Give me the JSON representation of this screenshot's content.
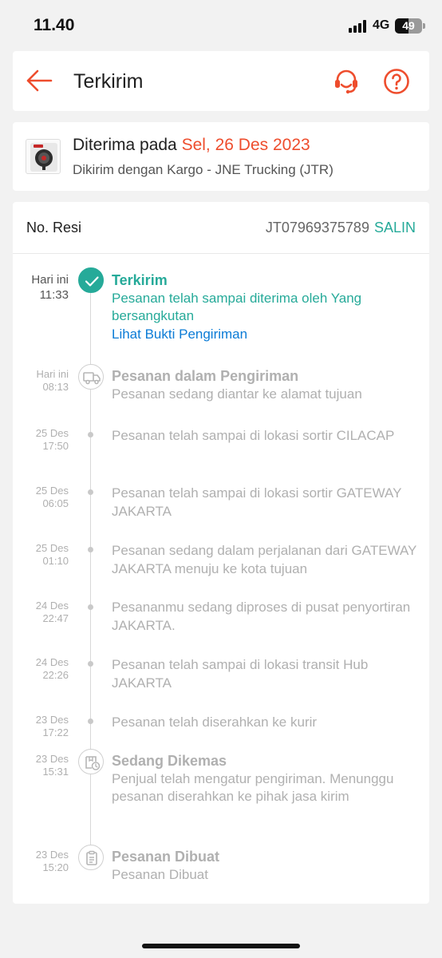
{
  "status_bar": {
    "time": "11.40",
    "network": "4G",
    "battery": "49",
    "battery_level": 0.49
  },
  "header": {
    "title": "Terkirim",
    "back_icon": "arrow-left-icon",
    "support_icon": "headset-icon",
    "help_icon": "question-circle-icon"
  },
  "colors": {
    "accent": "#ee4d2d",
    "success": "#26aa99",
    "link": "#0a7bd6"
  },
  "summary": {
    "received_label": "Diterima pada",
    "received_date": "Sel, 26 Des 2023",
    "courier_text": "Dikirim dengan Kargo - JNE Trucking (JTR)"
  },
  "tracking": {
    "resi_label": "No. Resi",
    "resi_number": "JT07969375789",
    "copy_label": "SALIN",
    "events": [
      {
        "date": "Hari ini",
        "time": "11:33",
        "title": "Terkirim",
        "desc": "Pesanan telah sampai diterima oleh Yang bersangkutan",
        "link": "Lihat Bukti Pengiriman",
        "icon": "check-icon",
        "active": true
      },
      {
        "date": "Hari ini",
        "time": "08:13",
        "title": "Pesanan dalam Pengiriman",
        "desc": "Pesanan sedang diantar ke alamat tujuan",
        "icon": "truck-icon"
      },
      {
        "date": "25 Des",
        "time": "17:50",
        "desc": "Pesanan telah sampai di lokasi sortir CILACAP"
      },
      {
        "date": "25 Des",
        "time": "06:05",
        "desc": "Pesanan telah sampai di lokasi sortir GATEWAY JAKARTA"
      },
      {
        "date": "25 Des",
        "time": "01:10",
        "desc": "Pesanan sedang dalam perjalanan dari GATEWAY JAKARTA menuju ke kota tujuan"
      },
      {
        "date": "24 Des",
        "time": "22:47",
        "desc": "Pesananmu sedang diproses di pusat penyortiran JAKARTA."
      },
      {
        "date": "24 Des",
        "time": "22:26",
        "desc": "Pesanan telah sampai di lokasi transit Hub JAKARTA"
      },
      {
        "date": "23 Des",
        "time": "17:22",
        "desc": "Pesanan telah diserahkan ke kurir"
      },
      {
        "date": "23 Des",
        "time": "15:31",
        "title": "Sedang Dikemas",
        "desc": "Penjual telah mengatur pengiriman. Menunggu pesanan diserahkan ke pihak jasa kirim",
        "icon": "package-clock-icon"
      },
      {
        "date": "23 Des",
        "time": "15:20",
        "title": "Pesanan Dibuat",
        "desc": "Pesanan Dibuat",
        "icon": "clipboard-icon"
      }
    ]
  }
}
